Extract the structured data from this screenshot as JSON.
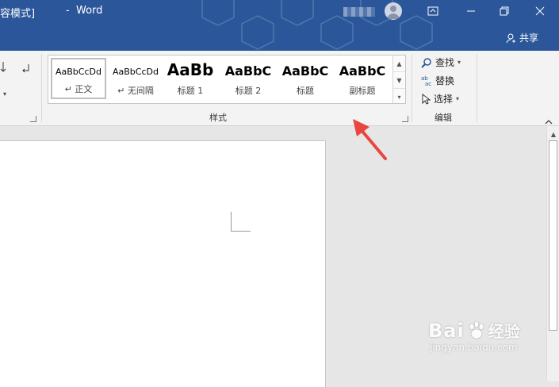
{
  "titlebar": {
    "doc_title_suffix": "容模式]",
    "separator": "-",
    "app_name": "Word",
    "share_label": "共享"
  },
  "ribbon": {
    "styles_group_label": "样式",
    "editing_group_label": "编辑",
    "styles": [
      {
        "sample": "AaBbCcDd",
        "label": "↵ 正文"
      },
      {
        "sample": "AaBbCcDd",
        "label": "↵ 无间隔"
      },
      {
        "sample": "AaBb",
        "label": "标题 1"
      },
      {
        "sample": "AaBbC",
        "label": "标题 2"
      },
      {
        "sample": "AaBbC",
        "label": "标题"
      },
      {
        "sample": "AaBbC",
        "label": "副标题"
      }
    ],
    "editing": {
      "find_label": "查找",
      "replace_label": "替换",
      "select_label": "选择"
    }
  },
  "watermark": {
    "brand": "Bai",
    "brand_cn": "经验",
    "url": "jingyan.baidu.com"
  },
  "colors": {
    "titlebar": "#2b579a",
    "annotation_arrow": "#e8463f"
  }
}
